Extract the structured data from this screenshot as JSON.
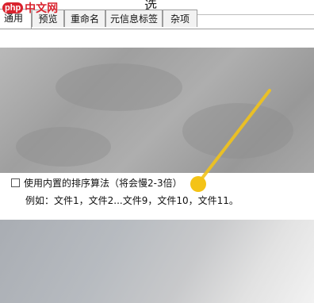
{
  "window": {
    "title": "选"
  },
  "logo": {
    "badge": "php",
    "text": "中文网"
  },
  "tabs": [
    {
      "label": "通用",
      "active": true
    },
    {
      "label": "预览",
      "active": false
    },
    {
      "label": "重命名",
      "active": false
    },
    {
      "label": "元信息标签",
      "active": false
    },
    {
      "label": "杂项",
      "active": false
    }
  ],
  "option": {
    "checkbox_label": "使用内置的排序算法（将会慢2-3倍）",
    "checked": false,
    "example_text": "例如：文件1，文件2...文件9，文件10，文件11。"
  },
  "colors": {
    "annotation": "#f2c41a",
    "logo_red": "#d9232e"
  }
}
